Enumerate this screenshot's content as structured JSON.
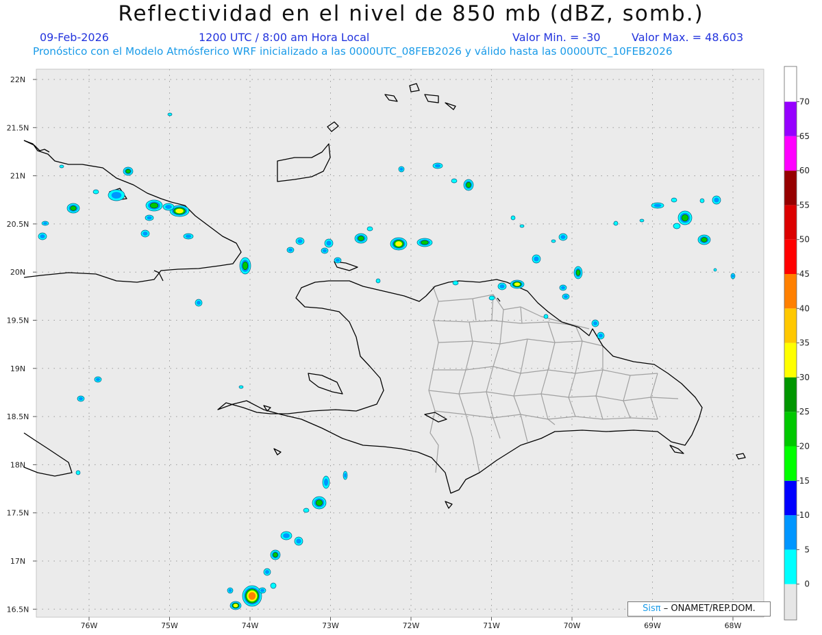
{
  "header": {
    "title": "Reflectividad en el nivel de 850 mb (dBZ, somb.)",
    "date": "09-Feb-2026",
    "time": "1200 UTC / 8:00 am Hora Local",
    "min_label": "Valor Min. = -30",
    "max_label": "Valor Max. = 48.603",
    "forecast_line": "Pronóstico con el Modelo Atmósferico WRF inicializado a las 0000UTC_08FEB2026 y válido hasta las  0000UTC_10FEB2026"
  },
  "map": {
    "lat_labels": [
      "22N",
      "21.5N",
      "21N",
      "20.5N",
      "20N",
      "19.5N",
      "19N",
      "18.5N",
      "18N",
      "17.5N",
      "17N",
      "16.5N"
    ],
    "lon_labels": [
      "76W",
      "75W",
      "74W",
      "73W",
      "72W",
      "71W",
      "70W",
      "69W",
      "68W"
    ],
    "background_color": "#ebebeb",
    "coast_color": "#000000",
    "province_border_color": "#a0a0a0"
  },
  "colorbar": {
    "labels": [
      "0",
      "5",
      "10",
      "15",
      "20",
      "25",
      "30",
      "35",
      "40",
      "45",
      "50",
      "55",
      "60",
      "65",
      "70"
    ],
    "colors": [
      "#00ffff",
      "#0096ff",
      "#0000ff",
      "#00ff00",
      "#00c800",
      "#009600",
      "#ffff00",
      "#ffc800",
      "#ff8000",
      "#ff0000",
      "#dc0000",
      "#960000",
      "#ff00ff",
      "#9600ff"
    ]
  },
  "credit": {
    "logo": "Sisπ",
    "text": "– ONAMET/REP.DOM."
  }
}
